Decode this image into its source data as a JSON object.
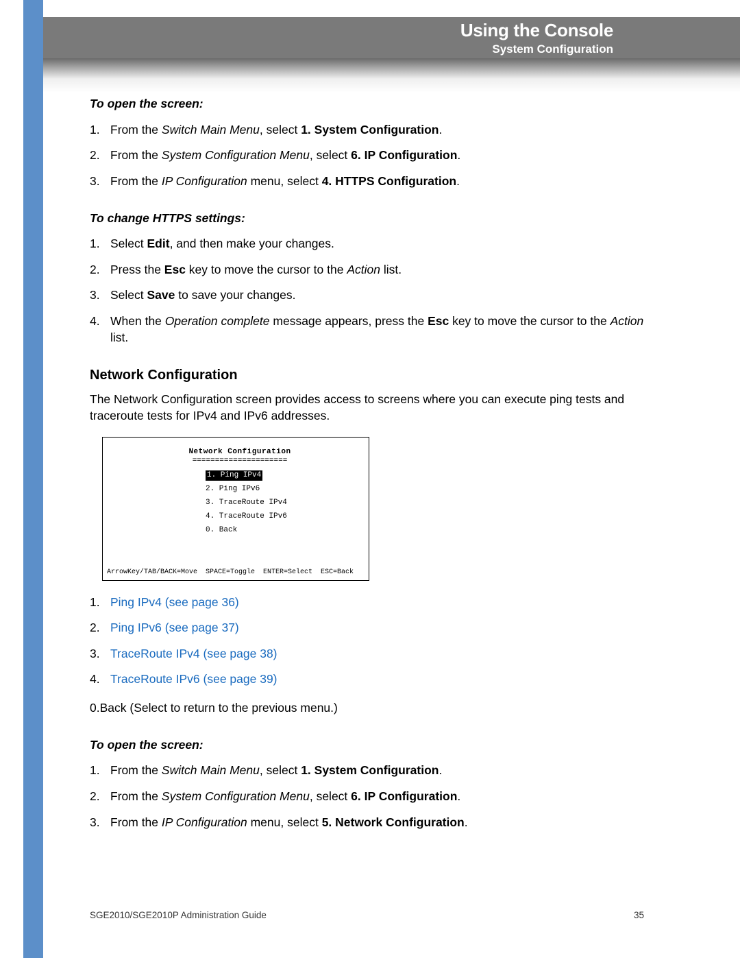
{
  "header": {
    "title": "Using the Console",
    "subtitle": "System Configuration"
  },
  "sectionA": {
    "heading": "To open the screen:",
    "steps": [
      {
        "pre": "From the ",
        "it": "Switch Main Menu",
        "mid": ", select ",
        "bold": "1. System Configuration",
        "post": "."
      },
      {
        "pre": "From the ",
        "it": "System Configuration Menu",
        "mid": ", select ",
        "bold": "6. IP Configuration",
        "post": "."
      },
      {
        "pre": "From the ",
        "it": "IP Configuration",
        "mid": " menu, select ",
        "bold": "4. HTTPS Configuration",
        "post": "."
      }
    ]
  },
  "sectionB": {
    "heading": "To change HTTPS settings:",
    "steps": [
      {
        "parts": [
          "Select ",
          "Edit",
          ", and then make your changes."
        ]
      },
      {
        "parts": [
          "Press the ",
          "Esc",
          " key to move the cursor to the ",
          "Action",
          " list."
        ]
      },
      {
        "parts": [
          "Select ",
          "Save",
          " to save your changes."
        ]
      },
      {
        "parts": [
          "When the ",
          "Operation complete",
          " message appears, press the ",
          "Esc",
          " key to move the cursor to the ",
          "Action",
          " list."
        ]
      }
    ]
  },
  "netconf": {
    "heading": "Network Configuration",
    "para": "The Network Configuration screen provides access to screens where you can execute ping tests and traceroute tests for IPv4 and IPv6 addresses.",
    "console": {
      "title": "Network Configuration",
      "sep": "=====================",
      "items": [
        "1. Ping IPv4",
        "2. Ping IPv6",
        "3. TraceRoute IPv4",
        "4. TraceRoute IPv6",
        "0. Back"
      ],
      "footer": "ArrowKey/TAB/BACK=Move  SPACE=Toggle  ENTER=Select  ESC=Back"
    },
    "links": [
      {
        "n": "1.",
        "text": "Ping IPv4 (see page 36)"
      },
      {
        "n": "2.",
        "text": "Ping IPv6 (see page 37)"
      },
      {
        "n": "3.",
        "text": "TraceRoute IPv4 (see page 38)"
      },
      {
        "n": "4.",
        "text": "TraceRoute IPv6 (see page 39)"
      }
    ],
    "backline": "0.Back (Select to return to the previous menu.)"
  },
  "sectionD": {
    "heading": "To open the screen:",
    "steps": [
      {
        "pre": "From the ",
        "it": "Switch Main Menu",
        "mid": ", select ",
        "bold": "1. System Configuration",
        "post": "."
      },
      {
        "pre": "From the ",
        "it": "System Configuration Menu",
        "mid": ", select ",
        "bold": "6. IP Configuration",
        "post": "."
      },
      {
        "pre": "From the ",
        "it": "IP Configuration",
        "mid": " menu, select ",
        "bold": "5. Network Configuration",
        "post": "."
      }
    ]
  },
  "footer": {
    "left": "SGE2010/SGE2010P Administration Guide",
    "right": "35"
  }
}
